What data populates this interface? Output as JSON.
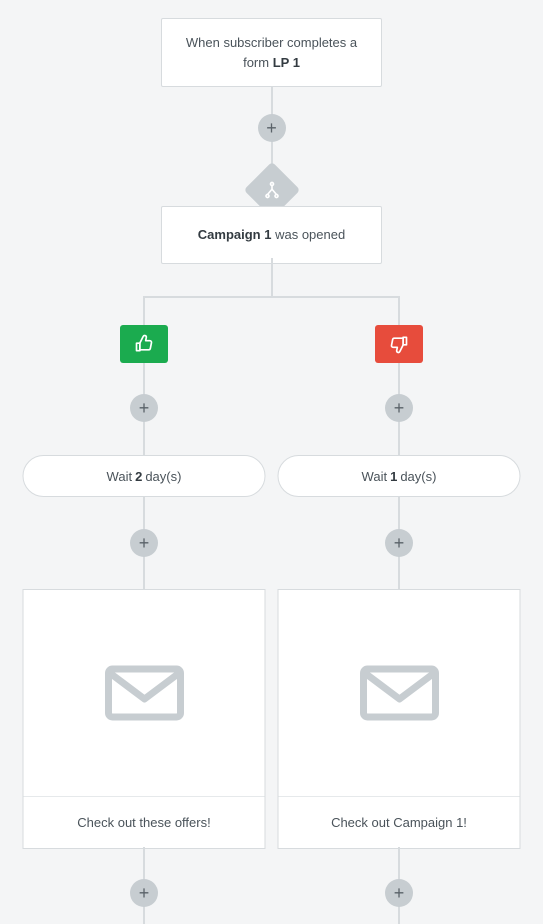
{
  "trigger": {
    "prefix": "When subscriber completes a",
    "line2_prefix": "form",
    "form_name": "LP 1"
  },
  "condition": {
    "campaign_name": "Campaign 1",
    "suffix": "was opened"
  },
  "branches": {
    "yes": {
      "wait_prefix": "Wait",
      "wait_value": "2",
      "wait_suffix": "day(s)",
      "email_title": "Check out these offers!"
    },
    "no": {
      "wait_prefix": "Wait",
      "wait_value": "1",
      "wait_suffix": "day(s)",
      "email_title": "Check out Campaign 1!"
    }
  },
  "icons": {
    "plus": "+"
  }
}
